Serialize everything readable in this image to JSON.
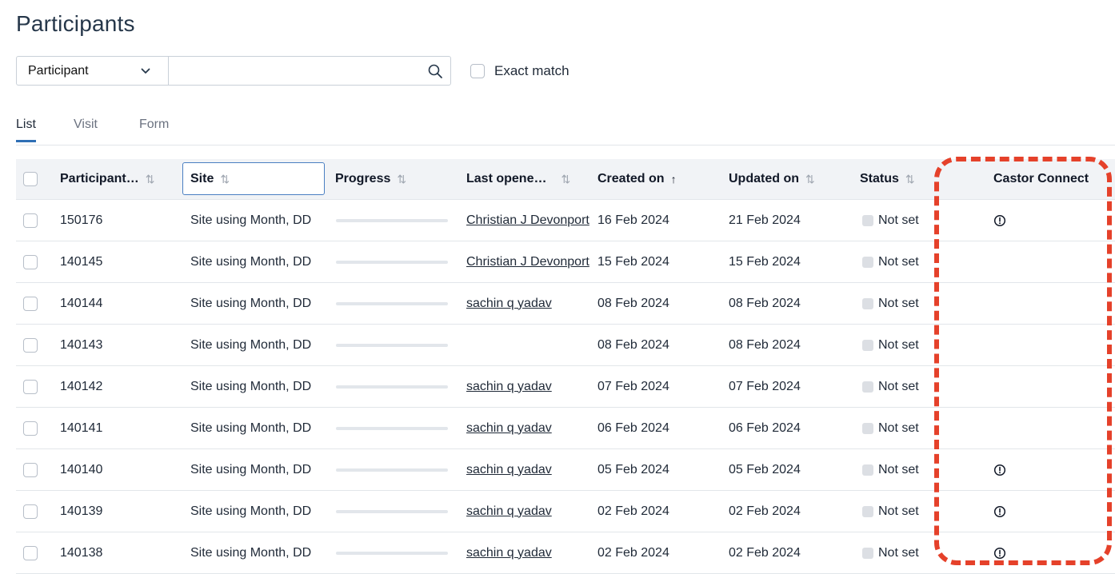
{
  "page": {
    "title": "Participants"
  },
  "search": {
    "field_selector": "Participant",
    "query": "",
    "placeholder": "",
    "exact_match_label": "Exact match",
    "exact_match_checked": false
  },
  "tabs": [
    {
      "label": "List",
      "active": true
    },
    {
      "label": "Visit",
      "active": false
    },
    {
      "label": "Form",
      "active": false
    }
  ],
  "table": {
    "columns": {
      "participant": "Participant…",
      "site": "Site",
      "progress": "Progress",
      "last_opened": "Last opene…",
      "created_on": "Created on",
      "updated_on": "Updated on",
      "status": "Status",
      "castor_connect": "Castor Connect"
    },
    "sort_icons": {
      "unsorted": "⇅",
      "ascending": "↑"
    },
    "rows": [
      {
        "id": "150176",
        "site": "Site using Month, DD",
        "last_opened": "Christian J Devonport",
        "created_on": "16 Feb 2024",
        "updated_on": "21 Feb 2024",
        "status": "Not set",
        "castor_connect": "alert-icon"
      },
      {
        "id": "140145",
        "site": "Site using Month, DD",
        "last_opened": "Christian J Devonport",
        "created_on": "15 Feb 2024",
        "updated_on": "15 Feb 2024",
        "status": "Not set",
        "castor_connect": ""
      },
      {
        "id": "140144",
        "site": "Site using Month, DD",
        "last_opened": "sachin q yadav",
        "created_on": "08 Feb 2024",
        "updated_on": "08 Feb 2024",
        "status": "Not set",
        "castor_connect": ""
      },
      {
        "id": "140143",
        "site": "Site using Month, DD",
        "last_opened": "",
        "created_on": "08 Feb 2024",
        "updated_on": "08 Feb 2024",
        "status": "Not set",
        "castor_connect": ""
      },
      {
        "id": "140142",
        "site": "Site using Month, DD",
        "last_opened": "sachin q yadav",
        "created_on": "07 Feb 2024",
        "updated_on": "07 Feb 2024",
        "status": "Not set",
        "castor_connect": ""
      },
      {
        "id": "140141",
        "site": "Site using Month, DD",
        "last_opened": "sachin q yadav",
        "created_on": "06 Feb 2024",
        "updated_on": "06 Feb 2024",
        "status": "Not set",
        "castor_connect": ""
      },
      {
        "id": "140140",
        "site": "Site using Month, DD",
        "last_opened": "sachin q yadav",
        "created_on": "05 Feb 2024",
        "updated_on": "05 Feb 2024",
        "status": "Not set",
        "castor_connect": "alert-icon"
      },
      {
        "id": "140139",
        "site": "Site using Month, DD",
        "last_opened": "sachin q yadav",
        "created_on": "02 Feb 2024",
        "updated_on": "02 Feb 2024",
        "status": "Not set",
        "castor_connect": "alert-icon"
      },
      {
        "id": "140138",
        "site": "Site using Month, DD",
        "last_opened": "sachin q yadav",
        "created_on": "02 Feb 2024",
        "updated_on": "02 Feb 2024",
        "status": "Not set",
        "castor_connect": "alert-icon"
      }
    ]
  },
  "colors": {
    "accent": "#2f6fb5",
    "highlight": "#e5412a",
    "header_bg": "#f1f3f6"
  }
}
